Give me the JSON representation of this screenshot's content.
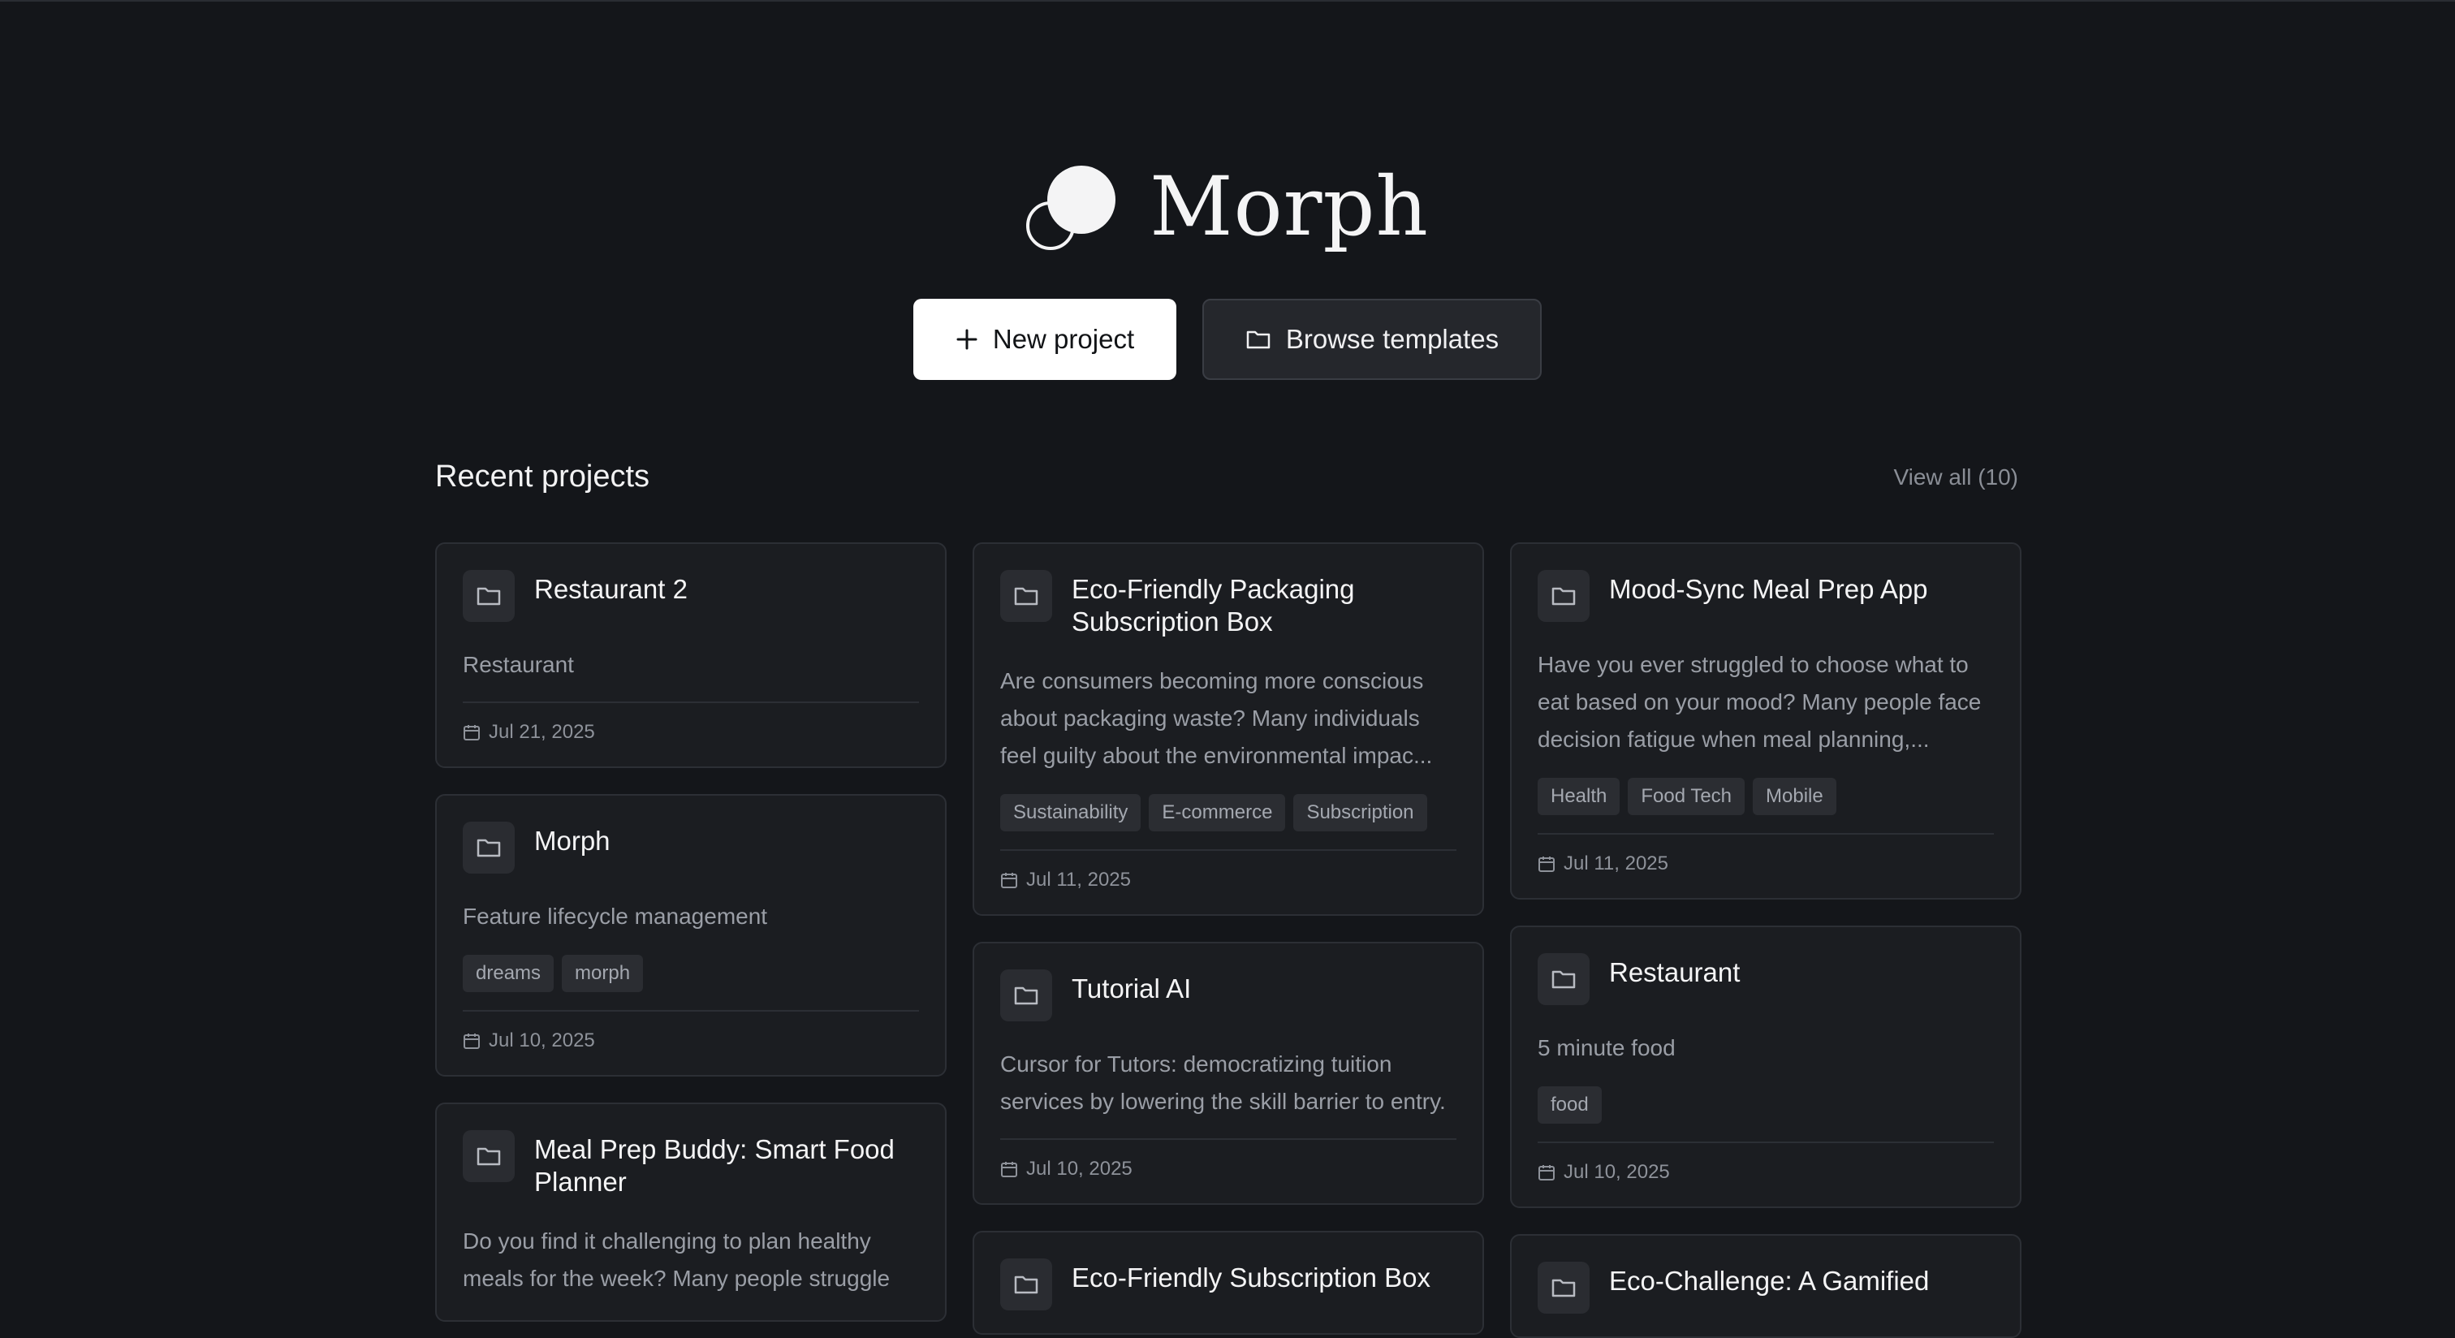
{
  "app": {
    "name": "Morph"
  },
  "actions": {
    "new_project": "New project",
    "browse_templates": "Browse templates"
  },
  "recent": {
    "title": "Recent projects",
    "view_all": "View all (10)"
  },
  "projects": [
    {
      "title": "Restaurant 2",
      "desc": "Restaurant",
      "tags": [],
      "date": "Jul 21, 2025"
    },
    {
      "title": "Morph",
      "desc": "Feature lifecycle management",
      "tags": [
        "dreams",
        "morph"
      ],
      "date": "Jul 10, 2025"
    },
    {
      "title": "Meal Prep Buddy: Smart Food Planner",
      "desc": "Do you find it challenging to plan healthy meals for the week? Many people struggle",
      "tags": [],
      "date": ""
    },
    {
      "title": "Eco-Friendly Packaging Subscription Box",
      "desc": "Are consumers becoming more conscious about packaging waste? Many individuals feel guilty about the environmental impac...",
      "tags": [
        "Sustainability",
        "E-commerce",
        "Subscription"
      ],
      "date": "Jul 11, 2025"
    },
    {
      "title": "Tutorial AI",
      "desc": "Cursor for Tutors: democratizing tuition services by lowering the skill barrier to entry.",
      "tags": [],
      "date": "Jul 10, 2025"
    },
    {
      "title": "Eco-Friendly Subscription Box",
      "desc": "",
      "tags": [],
      "date": ""
    },
    {
      "title": "Mood-Sync Meal Prep App",
      "desc": "Have you ever struggled to choose what to eat based on your mood? Many people face decision fatigue when meal planning,...",
      "tags": [
        "Health",
        "Food Tech",
        "Mobile"
      ],
      "date": "Jul 11, 2025"
    },
    {
      "title": "Restaurant",
      "desc": "5 minute food",
      "tags": [
        "food"
      ],
      "date": "Jul 10, 2025"
    },
    {
      "title": "Eco-Challenge: A Gamified",
      "desc": "",
      "tags": [],
      "date": ""
    }
  ],
  "icons": {
    "logo": "morph-logo-icon",
    "plus": "plus-icon",
    "folder": "folder-icon",
    "calendar": "calendar-icon"
  }
}
